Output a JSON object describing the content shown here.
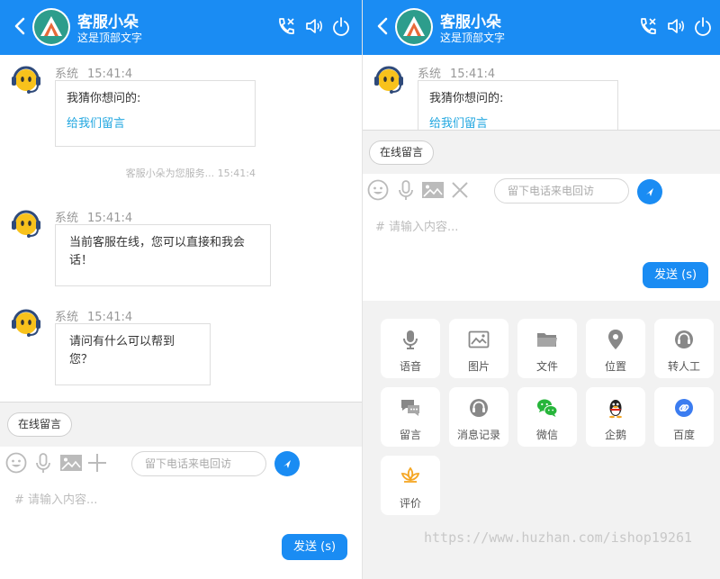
{
  "header": {
    "name": "客服小朵",
    "subtitle": "这是顶部文字"
  },
  "colors": {
    "brand": "#1a8cf3",
    "link": "#22a7e0",
    "gray_bg": "#f2f2f2"
  },
  "left_chat": {
    "messages": [
      {
        "sender": "系统",
        "time": "15:41:4",
        "lines": [
          "我猜你想问的:"
        ],
        "link": "给我们留言"
      },
      {
        "sender": "系统",
        "time": "15:41:4",
        "lines": [
          "当前客服在线，您可以直接和我会",
          "话！"
        ]
      },
      {
        "sender": "系统",
        "time": "15:41:4",
        "lines": [
          "请问有什么可以帮到",
          "您？"
        ]
      }
    ],
    "system_notice": "客服小朵为您服务... 15:41:4"
  },
  "right_chat": {
    "message": {
      "sender": "系统",
      "time": "15:41:4",
      "lines": [
        "我猜你想问的:"
      ],
      "link": "给我们留言"
    }
  },
  "compose": {
    "leave_message_button": "在线留言",
    "phone_placeholder": "留下电话来电回访",
    "input_placeholder": "# 请输入内容...",
    "send_label": "发送 (s)"
  },
  "toolbar_icons": {
    "left": [
      "emoji-icon",
      "microphone-icon",
      "image-icon",
      "plus-icon"
    ],
    "right": [
      "emoji-icon",
      "microphone-icon",
      "image-icon",
      "close-icon"
    ]
  },
  "functions": [
    {
      "label": "语音",
      "icon": "microphone-icon"
    },
    {
      "label": "图片",
      "icon": "image-icon"
    },
    {
      "label": "文件",
      "icon": "folder-icon"
    },
    {
      "label": "位置",
      "icon": "location-icon"
    },
    {
      "label": "转人工",
      "icon": "headset-icon"
    },
    {
      "label": "留言",
      "icon": "chat-bubble-icon"
    },
    {
      "label": "消息记录",
      "icon": "headset-icon"
    },
    {
      "label": "微信",
      "icon": "wechat-icon"
    },
    {
      "label": "企鹅",
      "icon": "qq-icon"
    },
    {
      "label": "百度",
      "icon": "baidu-icon"
    },
    {
      "label": "评价",
      "icon": "lotus-icon"
    }
  ],
  "watermark": "https://www.huzhan.com/ishop19261"
}
